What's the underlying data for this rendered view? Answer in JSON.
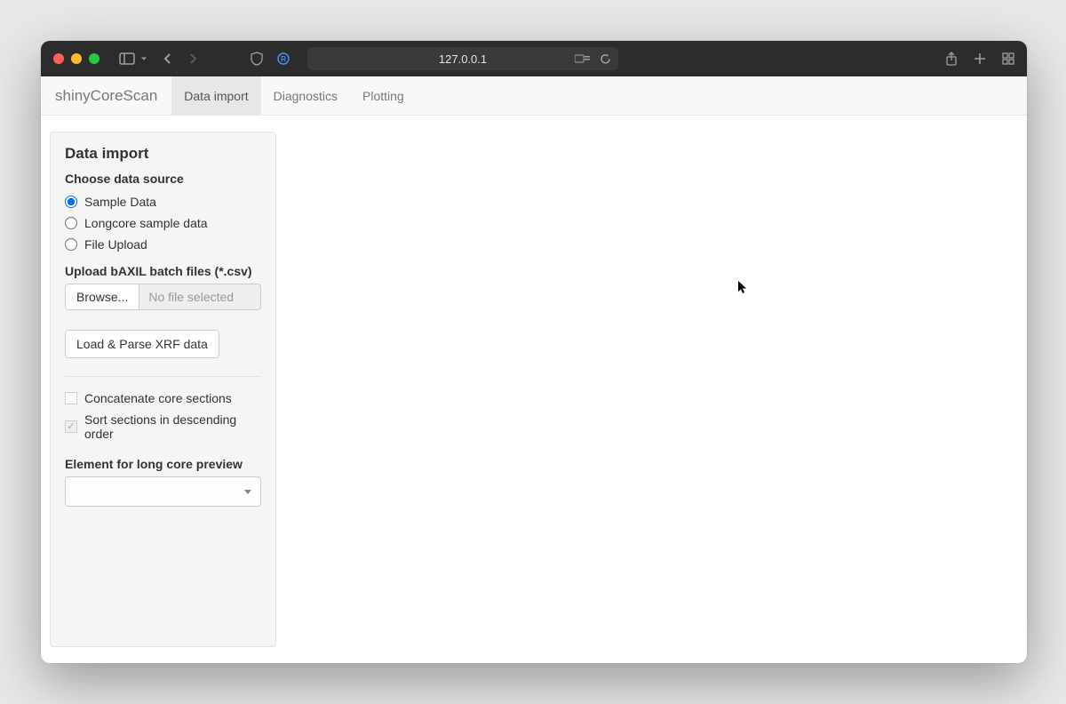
{
  "titlebar": {
    "url": "127.0.0.1"
  },
  "appbar": {
    "brand": "shinyCoreScan",
    "tabs": [
      {
        "label": "Data import",
        "active": true
      },
      {
        "label": "Diagnostics",
        "active": false
      },
      {
        "label": "Plotting",
        "active": false
      }
    ]
  },
  "sidebar": {
    "title": "Data import",
    "source_label": "Choose data source",
    "sources": [
      {
        "label": "Sample Data",
        "checked": true
      },
      {
        "label": "Longcore sample data",
        "checked": false
      },
      {
        "label": "File Upload",
        "checked": false
      }
    ],
    "upload_label": "Upload bAXIL batch files (*.csv)",
    "browse_label": "Browse...",
    "file_status": "No file selected",
    "load_button": "Load & Parse XRF data",
    "concat_label": "Concatenate core sections",
    "concat_checked": false,
    "sort_label": "Sort sections in descending order",
    "sort_checked": true,
    "preview_label": "Element for long core preview",
    "preview_value": ""
  }
}
